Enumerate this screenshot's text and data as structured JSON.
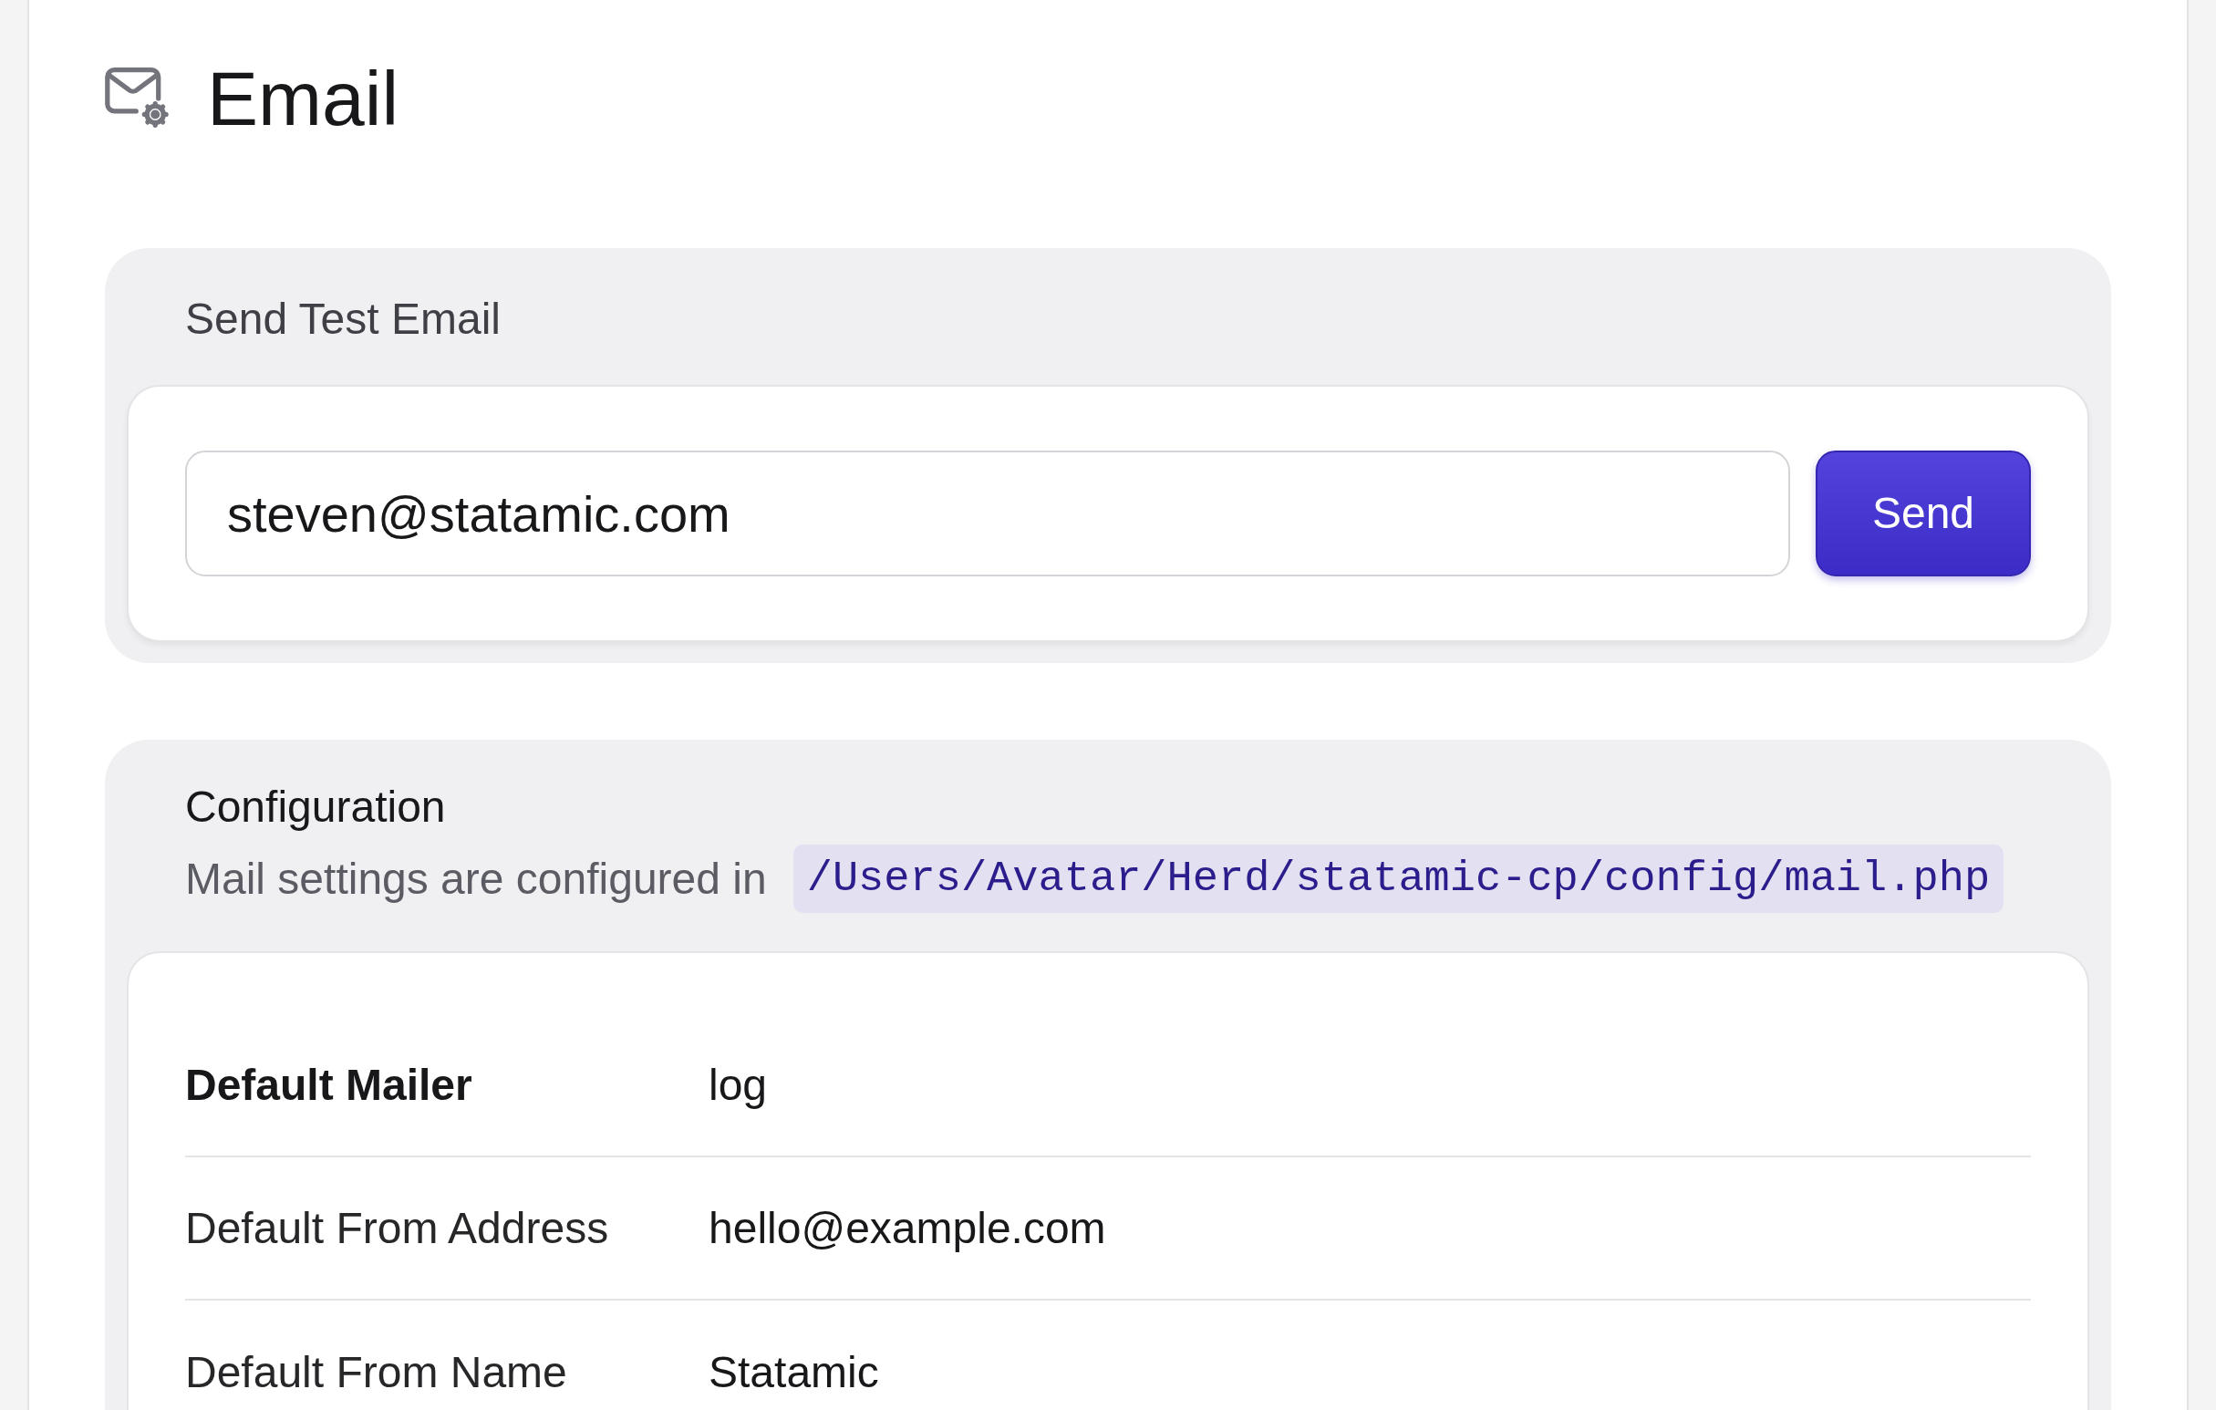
{
  "header": {
    "title": "Email"
  },
  "test_email": {
    "title": "Send Test Email",
    "email_field": {
      "value": "steven@statamic.com"
    },
    "button": "Send"
  },
  "configuration": {
    "title": "Configuration",
    "description": "Mail settings are configured in",
    "config_path": "/Users/Avatar/Herd/statamic-cp/config/mail.php",
    "rows": [
      {
        "label": "Default Mailer",
        "value": "log",
        "emphasized": true
      },
      {
        "label": "Default From Address",
        "value": "hello@example.com",
        "emphasized": false
      },
      {
        "label": "Default From Name",
        "value": "Statamic",
        "emphasized": false
      }
    ]
  }
}
